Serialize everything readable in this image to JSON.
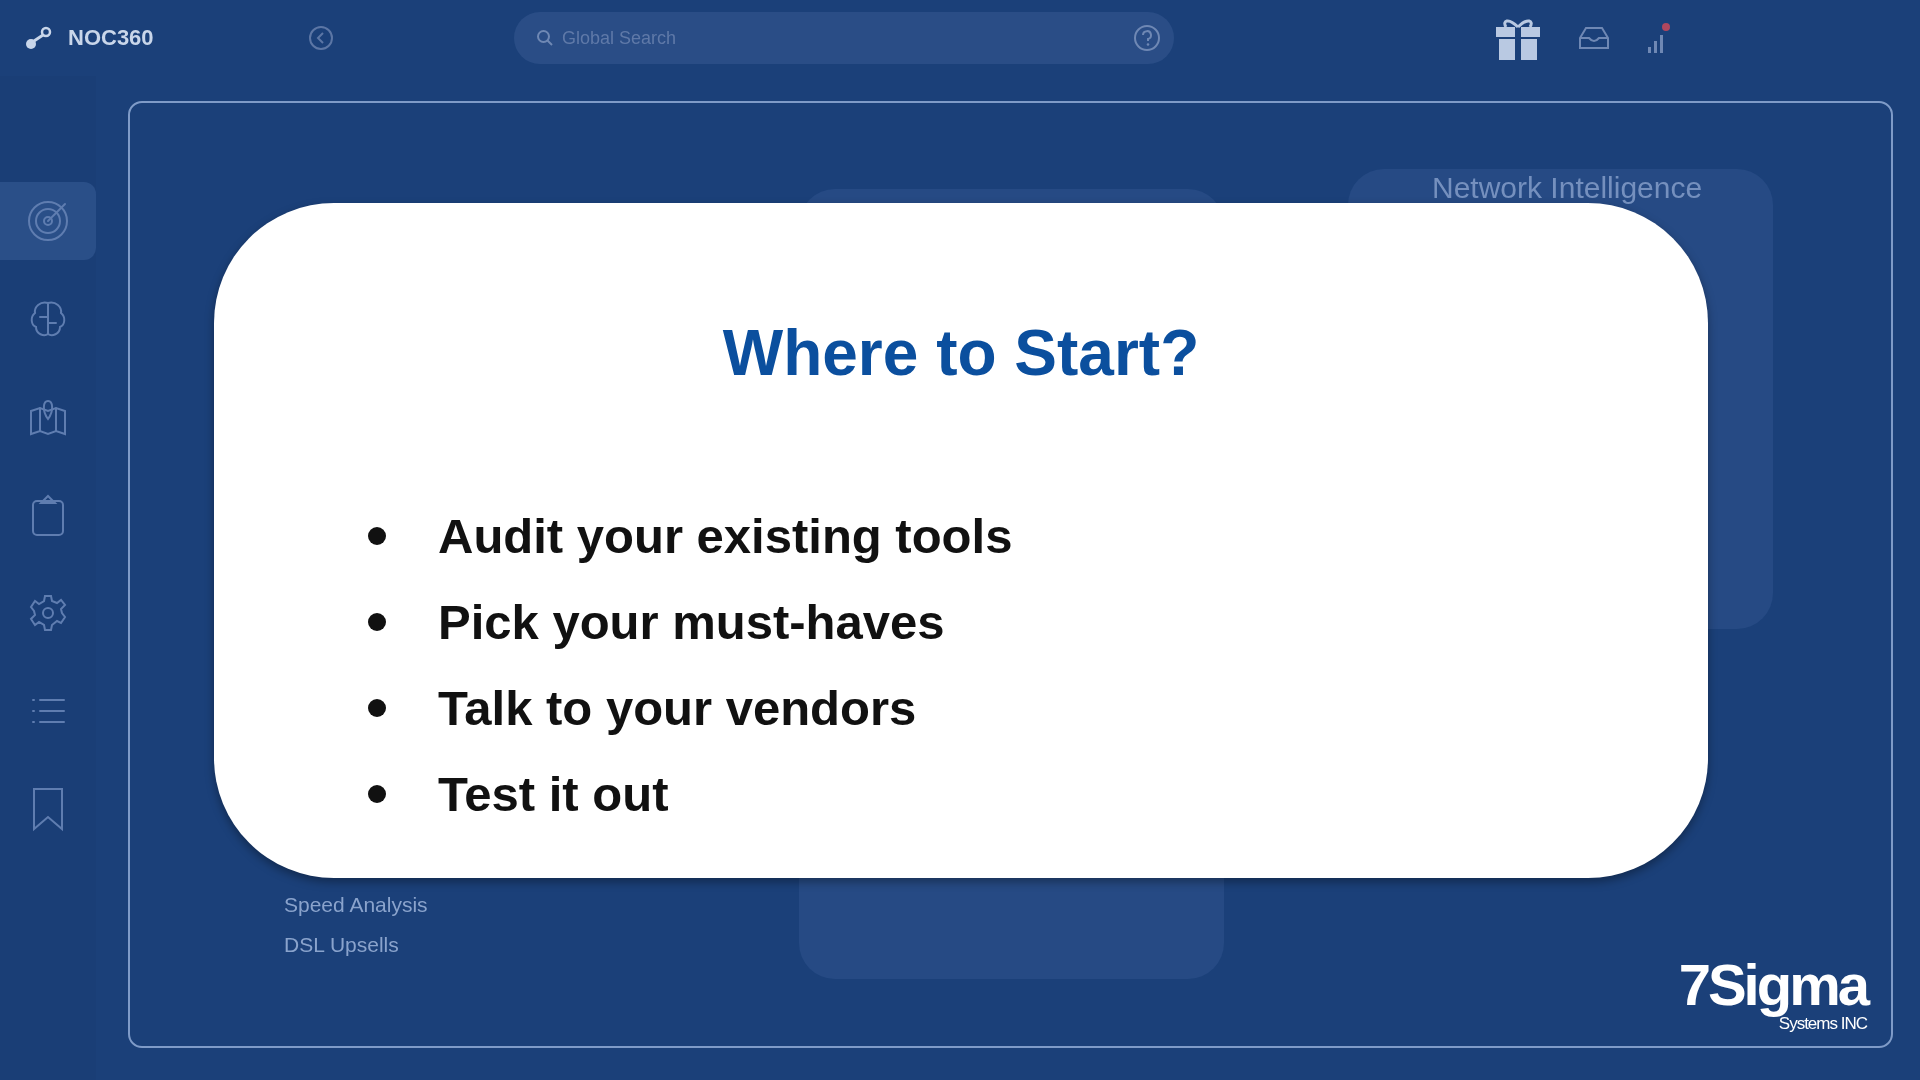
{
  "app": {
    "name": "NOC360"
  },
  "search": {
    "placeholder": "Global Search"
  },
  "sidebar": {
    "items": [
      {
        "kind": "radar",
        "selected": true
      },
      {
        "kind": "brain",
        "selected": false
      },
      {
        "kind": "map",
        "selected": false
      },
      {
        "kind": "clipboard",
        "selected": false
      },
      {
        "kind": "gear",
        "selected": false
      },
      {
        "kind": "list",
        "selected": false
      },
      {
        "kind": "bookmark",
        "selected": false
      }
    ]
  },
  "background_cards": [
    {
      "links": [
        "Speed Analysis",
        "DSL Upsells"
      ]
    },
    {
      "title": "Network Intelligence"
    }
  ],
  "slide": {
    "title": "Where to Start?",
    "bullets": [
      "Audit your existing tools",
      "Pick your must-haves",
      "Talk to your vendors",
      "Test it out"
    ]
  },
  "logo": {
    "name": "7Sigma",
    "subtitle": "Systems INC"
  }
}
